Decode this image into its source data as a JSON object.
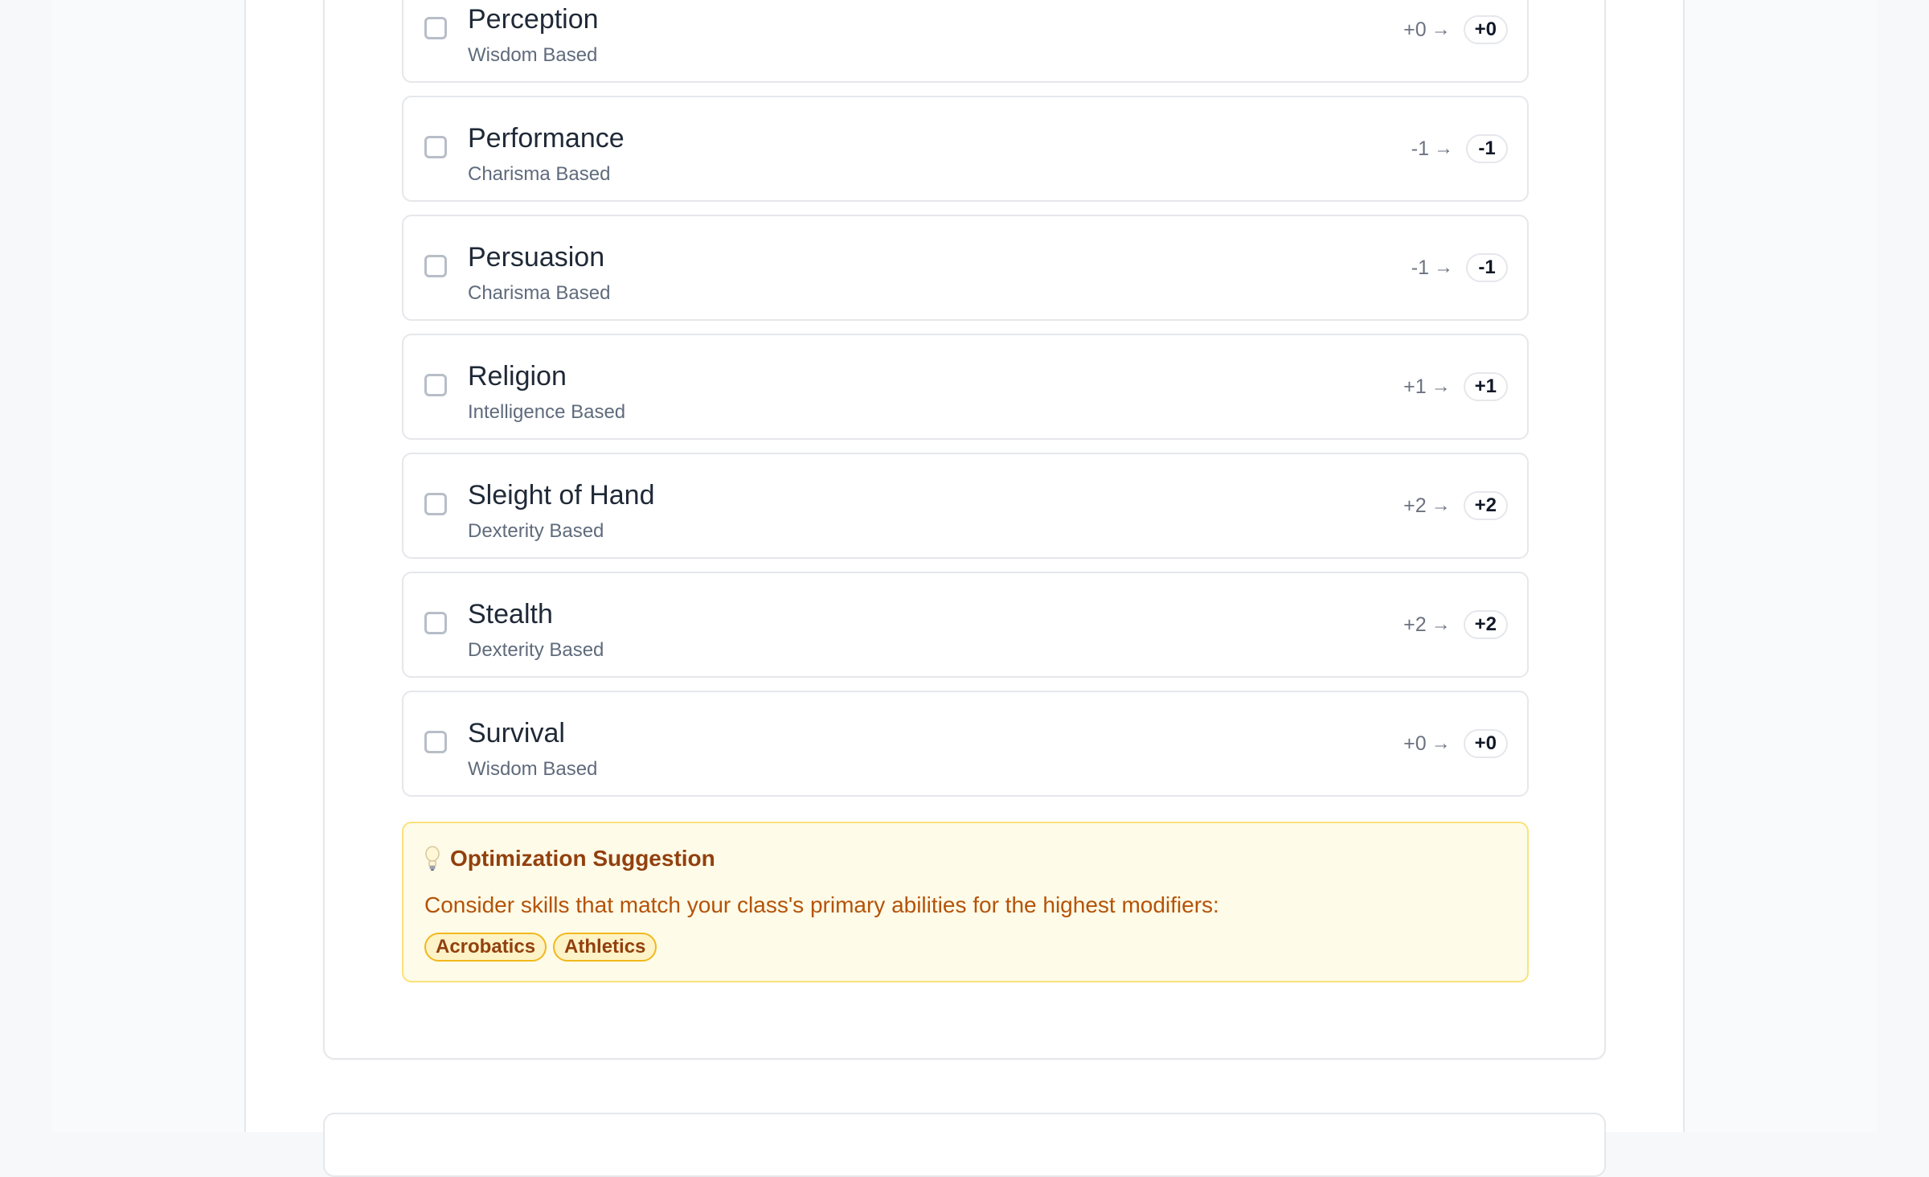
{
  "skills": [
    {
      "name": "Perception",
      "ability": "Wisdom Based",
      "base": "+0",
      "total": "+0"
    },
    {
      "name": "Performance",
      "ability": "Charisma Based",
      "base": "-1",
      "total": "-1"
    },
    {
      "name": "Persuasion",
      "ability": "Charisma Based",
      "base": "-1",
      "total": "-1"
    },
    {
      "name": "Religion",
      "ability": "Intelligence Based",
      "base": "+1",
      "total": "+1"
    },
    {
      "name": "Sleight of Hand",
      "ability": "Dexterity Based",
      "base": "+2",
      "total": "+2"
    },
    {
      "name": "Stealth",
      "ability": "Dexterity Based",
      "base": "+2",
      "total": "+2"
    },
    {
      "name": "Survival",
      "ability": "Wisdom Based",
      "base": "+0",
      "total": "+0"
    }
  ],
  "arrow": "→",
  "suggestion": {
    "icon": "lightbulb-icon",
    "title": "Optimization Suggestion",
    "text": "Consider skills that match your class's primary abilities for the highest modifiers:",
    "tags": [
      "Acrobatics",
      "Athletics"
    ]
  },
  "colors": {
    "suggestion_bg": "#fefbe8",
    "suggestion_border": "#fbe27a",
    "suggestion_title": "#92400e",
    "suggestion_text": "#b45309",
    "tag_border": "#f1b81c",
    "tag_bg": "#fef3c7"
  }
}
